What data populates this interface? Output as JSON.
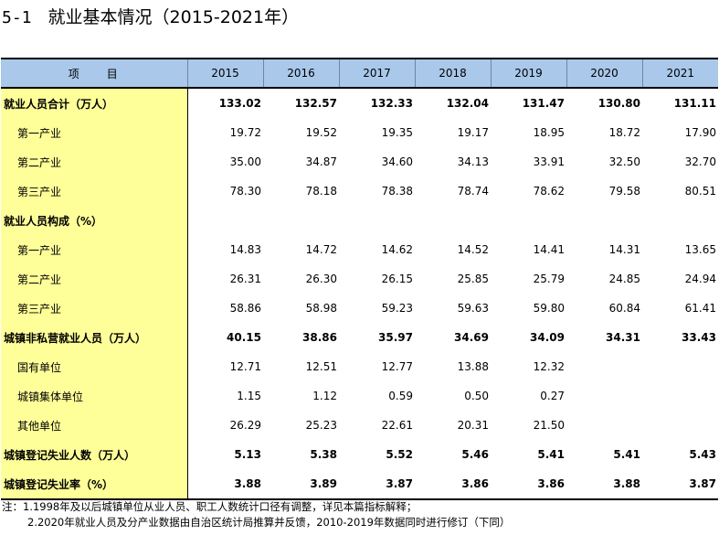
{
  "title": {
    "number": "5-1",
    "text": "就业基本情况（2015-2021年）"
  },
  "table": {
    "header": {
      "label": "项　　目",
      "years": [
        "2015",
        "2016",
        "2017",
        "2018",
        "2019",
        "2020",
        "2021"
      ]
    },
    "rows": [
      {
        "label": "就业人员合计（万人）",
        "values": [
          "133.02",
          "132.57",
          "132.33",
          "132.04",
          "131.47",
          "130.80",
          "131.11"
        ]
      },
      {
        "label": "第一产业",
        "values": [
          "19.72",
          "19.52",
          "19.35",
          "19.17",
          "18.95",
          "18.72",
          "17.90"
        ]
      },
      {
        "label": "第二产业",
        "values": [
          "35.00",
          "34.87",
          "34.60",
          "34.13",
          "33.91",
          "32.50",
          "32.70"
        ]
      },
      {
        "label": "第三产业",
        "values": [
          "78.30",
          "78.18",
          "78.38",
          "78.74",
          "78.62",
          "79.58",
          "80.51"
        ]
      },
      {
        "label": "就业人员构成（%）",
        "values": [
          "",
          "",
          "",
          "",
          "",
          "",
          ""
        ]
      },
      {
        "label": "第一产业",
        "values": [
          "14.83",
          "14.72",
          "14.62",
          "14.52",
          "14.41",
          "14.31",
          "13.65"
        ]
      },
      {
        "label": "第二产业",
        "values": [
          "26.31",
          "26.30",
          "26.15",
          "25.85",
          "25.79",
          "24.85",
          "24.94"
        ]
      },
      {
        "label": "第三产业",
        "values": [
          "58.86",
          "58.98",
          "59.23",
          "59.63",
          "59.80",
          "60.84",
          "61.41"
        ]
      },
      {
        "label": "城镇非私营就业人员（万人）",
        "values": [
          "40.15",
          "38.86",
          "35.97",
          "34.69",
          "34.09",
          "34.31",
          "33.43"
        ]
      },
      {
        "label": "国有单位",
        "values": [
          "12.71",
          "12.51",
          "12.77",
          "13.88",
          "12.32",
          "",
          ""
        ]
      },
      {
        "label": "城镇集体单位",
        "values": [
          "1.15",
          "1.12",
          "0.59",
          "0.50",
          "0.27",
          "",
          ""
        ]
      },
      {
        "label": "其他单位",
        "values": [
          "26.29",
          "25.23",
          "22.61",
          "20.31",
          "21.50",
          "",
          ""
        ]
      },
      {
        "label": "城镇登记失业人数（万人）",
        "values": [
          "5.13",
          "5.38",
          "5.52",
          "5.46",
          "5.41",
          "5.41",
          "5.43"
        ]
      },
      {
        "label": "城镇登记失业率（%）",
        "values": [
          "3.88",
          "3.89",
          "3.87",
          "3.86",
          "3.86",
          "3.88",
          "3.87"
        ]
      }
    ]
  },
  "notes": {
    "line1": "注：1.1998年及以后城镇单位从业人员、职工人数统计口径有调整，详见本篇指标解释；",
    "line2": "2.2020年就业人员及分产业数据由自治区统计局推算并反馈，2010-2019年数据同时进行修订（下同）"
  }
}
